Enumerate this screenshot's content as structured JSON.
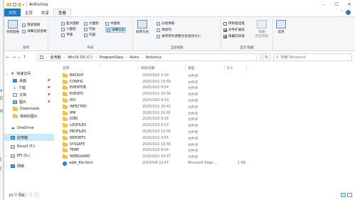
{
  "background_window": {
    "letters": [
      "v",
      "C",
      "V",
      "(",
      "("
    ]
  },
  "title": "Antivirus",
  "tabs": [
    "文件",
    "主页",
    "共享",
    "查看"
  ],
  "ribbon": {
    "panes_group": {
      "nav_pane": "导航窗格",
      "preview": "预览窗格",
      "details": "详细信息窗格",
      "label": "窗格"
    },
    "layout_group": {
      "items": [
        "超大图标",
        "大图标",
        "中图标",
        "小图标",
        "列表",
        "详细信息",
        "平铺",
        "内容"
      ],
      "label": "布局"
    },
    "view_group": {
      "sort": "排序方式",
      "group_by": "分组依据",
      "add_columns": "添加列",
      "fit_columns": "将所有列调整为合适的大小",
      "label": "当前视图"
    },
    "showhide_group": {
      "item_checkbox": "项目复选框",
      "extensions": "文件扩展名",
      "hidden": "隐藏的项目",
      "hide_selected": "隐藏\n所选项目",
      "label": "显示/隐藏"
    },
    "options": "选项"
  },
  "address": {
    "crumbs": [
      "此电脑",
      "Win10 OS (C:)",
      "ProgramData",
      "Avira",
      "Antivirus"
    ],
    "search_placeholder": "搜索\"Antivirus\""
  },
  "nav": {
    "quick_access": "快速访问",
    "items": [
      {
        "label": "桌面",
        "icon": "desktop-icon"
      },
      {
        "label": "下载",
        "icon": "download-icon"
      },
      {
        "label": "文档",
        "icon": "document-icon"
      },
      {
        "label": "图片",
        "icon": "picture-icon"
      },
      {
        "label": "Downloads",
        "icon": "folder-icon"
      },
      {
        "label": "保存的图片",
        "icon": "folder-icon"
      }
    ],
    "onedrive": "OneDrive",
    "this_pc": "此电脑",
    "drives": [
      "EasyU (F:)",
      "EFI (G:)"
    ],
    "network": "网络"
  },
  "columns": {
    "name": "名称",
    "date": "修改日期",
    "type": "类型",
    "size": "大小"
  },
  "files": [
    {
      "name": "BACKUP",
      "date": "2020/10/2 9:19",
      "type": "文件夹",
      "size": ""
    },
    {
      "name": "CONFIG",
      "date": "2020/10/1 19:56",
      "type": "文件夹",
      "size": ""
    },
    {
      "name": "EVENTDB",
      "date": "2020/10/2 9:54",
      "type": "文件夹",
      "size": ""
    },
    {
      "name": "EVENTS",
      "date": "2020/10/1 19:56",
      "type": "文件夹",
      "size": ""
    },
    {
      "name": "IDX",
      "date": "2020/10/2 9:19",
      "type": "文件夹",
      "size": ""
    },
    {
      "name": "INFECTED",
      "date": "2020/10/1 20:43",
      "type": "文件夹",
      "size": ""
    },
    {
      "name": "IPM",
      "date": "2020/10/1 20:02",
      "type": "文件夹",
      "size": ""
    },
    {
      "name": "JOBS",
      "date": "2020/10/2 9:18",
      "type": "文件夹",
      "size": ""
    },
    {
      "name": "LOGFILES",
      "date": "2020/10/2 9:53",
      "type": "文件夹",
      "size": ""
    },
    {
      "name": "PROFILES",
      "date": "2020/10/1 19:56",
      "type": "文件夹",
      "size": ""
    },
    {
      "name": "REPORTS",
      "date": "2020/10/2 9:54",
      "type": "文件夹",
      "size": ""
    },
    {
      "name": "SYSSAFE",
      "date": "2020/10/1 19:56",
      "type": "文件夹",
      "size": ""
    },
    {
      "name": "TEMP",
      "date": "2020/10/2 9:54",
      "type": "文件夹",
      "size": ""
    },
    {
      "name": "WEBGUARD",
      "date": "2020/10/1 19:57",
      "type": "文件夹",
      "size": ""
    },
    {
      "name": "addr_file.html",
      "date": "2019/5/8 22:47",
      "type": "Microsoft Edge ...",
      "size": "1 KB"
    }
  ],
  "status": {
    "count": "15 个项目"
  },
  "watermark": "华军软件园"
}
